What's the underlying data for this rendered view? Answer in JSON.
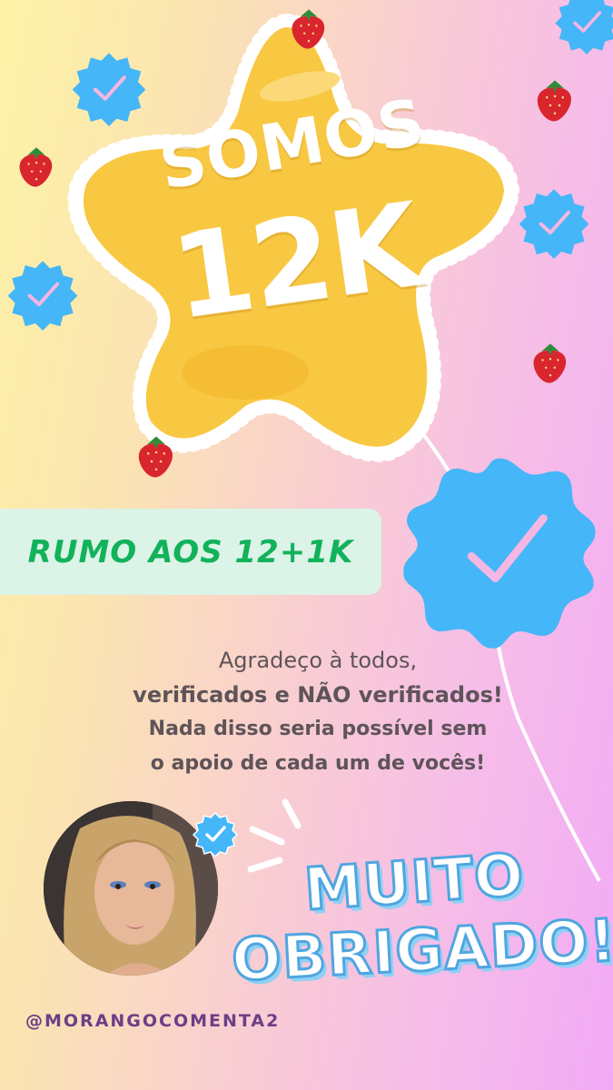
{
  "balloon": {
    "line1": "SOMOS",
    "line2": "12K"
  },
  "banner": {
    "text": "RUMO AOS 12+1K"
  },
  "message": {
    "line1": "Agradeço à todos,",
    "line2": "verificados e NÃO verificados!",
    "line3": "Nada disso seria possível sem",
    "line4": "o apoio de cada um de vocês!"
  },
  "thanks": {
    "line1": "MUITO",
    "line2": "OBRIGADO!"
  },
  "handle": "@MORANGOCOMENTA2",
  "icons": {
    "badge": "verified-badge-icon",
    "strawberry": "strawberry-icon"
  },
  "colors": {
    "badge_blue": "#45b6f7",
    "check_pink": "#f4b6e2",
    "banner_bg": "#dcf3e8",
    "banner_text": "#12b25a",
    "balloon": "#f8c842",
    "message_text": "#5e5459",
    "handle_text": "#6b3f86"
  }
}
